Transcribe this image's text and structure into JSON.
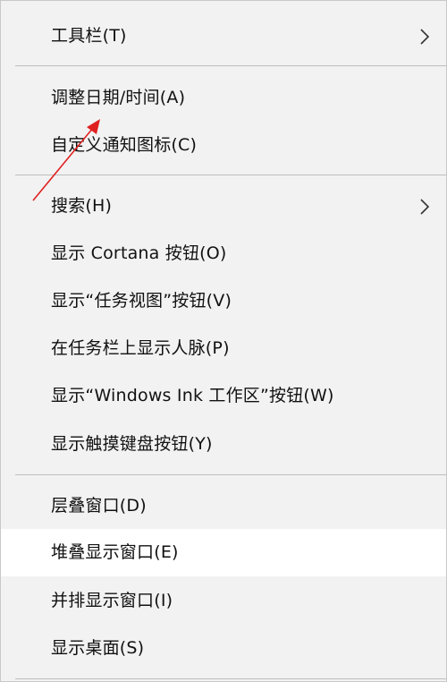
{
  "menu": {
    "toolbar": "工具栏(T)",
    "adjust_datetime": "调整日期/时间(A)",
    "customize_notify": "自定义通知图标(C)",
    "search": "搜索(H)",
    "show_cortana": "显示 Cortana 按钮(O)",
    "show_taskview": "显示“任务视图”按钮(V)",
    "show_people": "在任务栏上显示人脉(P)",
    "show_ink": "显示“Windows Ink 工作区”按钮(W)",
    "show_touchkb": "显示触摸键盘按钮(Y)",
    "cascade": "层叠窗口(D)",
    "stack": "堆叠显示窗口(E)",
    "side_by_side": "并排显示窗口(I)",
    "show_desktop": "显示桌面(S)"
  },
  "icons": {
    "submenu": "chevron-right-icon",
    "annotation": "red-arrow-annotation"
  },
  "colors": {
    "menu_bg": "#f2f2f2",
    "highlight_bg": "#ffffff",
    "annotation": "#e02020"
  }
}
